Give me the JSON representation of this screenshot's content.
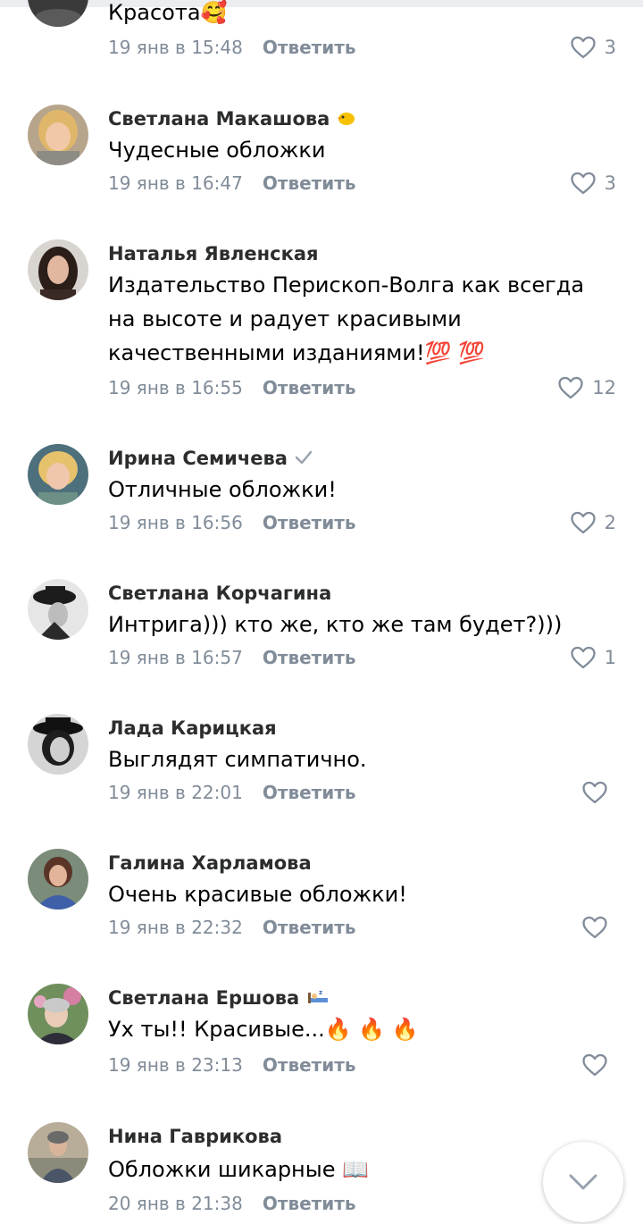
{
  "reply_label": "Ответить",
  "colors": {
    "text_secondary": "#818c99",
    "author": "#2c2d2e",
    "heart": "#818c99"
  },
  "comments": [
    {
      "author": "",
      "text": "Красота🥰",
      "time": "19 янв в 15:48",
      "likes": "3",
      "avatar": "dark-partial"
    },
    {
      "author": "Светлана Макашова",
      "badge_icon": "chick-emoji-icon",
      "text": "Чудесные обложки",
      "time": "19 янв в 16:47",
      "likes": "3",
      "avatar": "blonde-woman"
    },
    {
      "author": "Наталья Явленская",
      "text": "Издательство Перископ-Волга как всегда на высоте и радует красивыми качественными изданиями!💯 💯",
      "time": "19 янв в 16:55",
      "likes": "12",
      "avatar": "dark-hair-woman"
    },
    {
      "author": "Ирина Семичева",
      "badge_icon": "verified-check-icon",
      "text": "Отличные обложки!",
      "time": "19 янв в 16:56",
      "likes": "2",
      "avatar": "blonde-short-hair"
    },
    {
      "author": "Светлана Корчагина",
      "text": "Интрига))) кто же, кто же там будет?)))",
      "time": "19 янв в 16:57",
      "likes": "1",
      "avatar": "bw-hat-figure"
    },
    {
      "author": "Лада Карицкая",
      "text": "Выглядят симпатично.",
      "time": "19 янв в 22:01",
      "likes": "",
      "avatar": "bw-woman-hat"
    },
    {
      "author": "Галина Харламова",
      "text": "Очень красивые обложки!",
      "time": "19 янв в 22:32",
      "likes": "",
      "avatar": "woman-blue-dress"
    },
    {
      "author": "Светлана Ершова",
      "badge_icon": "sleeping-in-bed-emoji-icon",
      "text": "Ух ты!! Красивые...🔥 🔥 🔥",
      "time": "19 янв в 23:13",
      "likes": "",
      "avatar": "woman-flowers"
    },
    {
      "author": "Нина Гаврикова",
      "text": "Обложки шикарные 📖",
      "time": "20 янв в 21:38",
      "likes": "",
      "avatar": "woman-outdoor"
    }
  ],
  "scroll_button_icon": "chevron-down-icon"
}
